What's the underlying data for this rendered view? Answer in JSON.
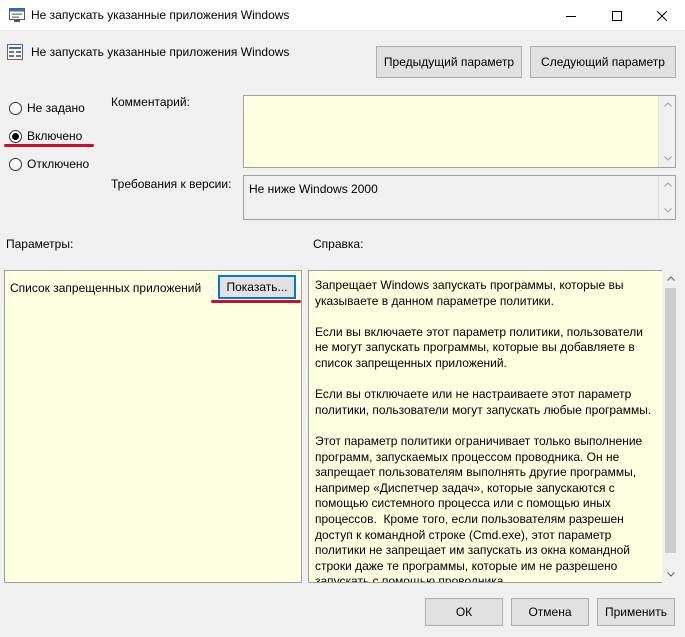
{
  "window": {
    "title": "Не запускать указанные приложения Windows",
    "icons": {
      "app": "policy-window-icon",
      "minimize": "minimize-icon",
      "maximize": "maximize-icon",
      "close": "close-icon"
    }
  },
  "policy": {
    "title": "Не запускать указанные приложения Windows",
    "icon": "policy-settings-icon",
    "prev_label": "Предыдущий параметр",
    "next_label": "Следующий параметр"
  },
  "state": {
    "options": [
      {
        "label": "Не задано",
        "selected": false
      },
      {
        "label": "Включено",
        "selected": true
      },
      {
        "label": "Отключено",
        "selected": false
      }
    ]
  },
  "comment": {
    "label": "Комментарий:",
    "value": ""
  },
  "version": {
    "label": "Требования к версии:",
    "value": "Не ниже Windows 2000"
  },
  "params": {
    "header": "Параметры:",
    "list_label": "Список запрещенных приложений",
    "show_button": "Показать..."
  },
  "help": {
    "header": "Справка:",
    "text": "Запрещает Windows запускать программы, которые вы указываете в данном параметре политики.\n\nЕсли вы включаете этот параметр политики, пользователи не могут запускать программы, которые вы добавляете в список запрещенных приложений.\n\nЕсли вы отключаете или не настраиваете этот параметр политики, пользователи могут запускать любые программы.\n\nЭтот параметр политики ограничивает только выполнение программ, запускаемых процессом проводника. Он не запрещает пользователям выполнять другие программы, например «Диспетчер задач», которые запускаются с помощью системного процесса или с помощью иных процессов.  Кроме того, если пользователям разрешен доступ к командной строке (Cmd.exe), этот параметр политики не запрещает им запускать из окна командной строки даже те программы, которые им не разрешено запускать с помощью проводника."
  },
  "footer": {
    "ok": "ОК",
    "cancel": "Отмена",
    "apply": "Применить"
  },
  "colors": {
    "annotation": "#c8102e",
    "panel_bg": "#ffffe1",
    "focus": "#0078d7"
  }
}
